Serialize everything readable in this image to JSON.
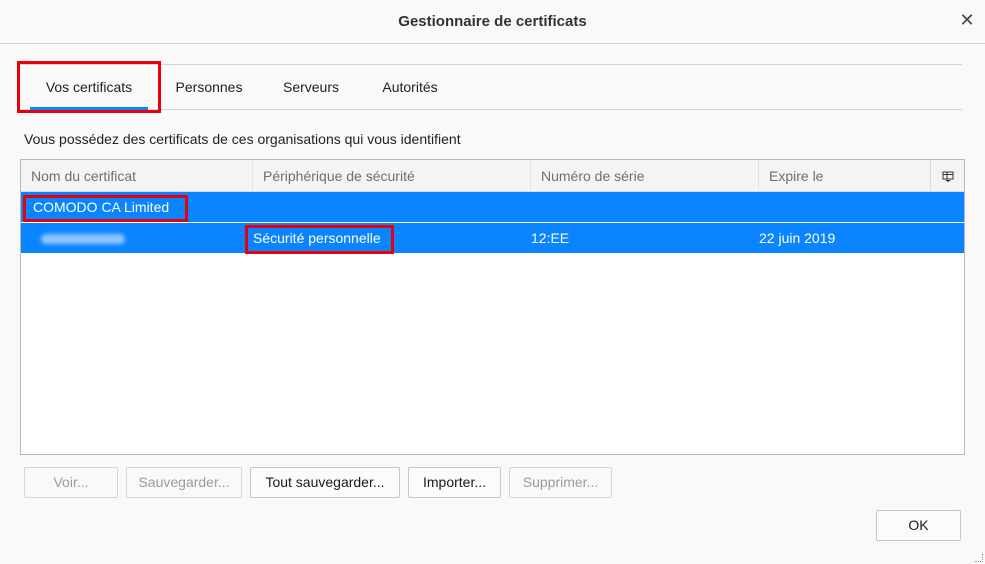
{
  "window": {
    "title": "Gestionnaire de certificats",
    "close_glyph": "✕"
  },
  "tabs": [
    {
      "label": "Vos certificats",
      "active": true
    },
    {
      "label": "Personnes",
      "active": false
    },
    {
      "label": "Serveurs",
      "active": false
    },
    {
      "label": "Autorités",
      "active": false
    }
  ],
  "description": "Vous possédez des certificats de ces organisations qui vous identifient",
  "table": {
    "columns": [
      "Nom du certificat",
      "Périphérique de sécurité",
      "Numéro de série",
      "Expire le"
    ],
    "column_picker_icon": "column-picker-icon",
    "group": {
      "name": "COMODO CA Limited"
    },
    "rows": [
      {
        "name": "",
        "device": "Sécurité personnelle",
        "serial_prefix": "12:EE",
        "expires": "22 juin 2019"
      }
    ]
  },
  "buttons": {
    "view": "Voir...",
    "backup": "Sauvegarder...",
    "backup_all": "Tout sauvegarder...",
    "import": "Importer...",
    "delete": "Supprimer...",
    "ok": "OK"
  },
  "colors": {
    "selection": "#0a84ff",
    "highlight": "#e8000b",
    "tab_indicator": "#0a84ff"
  }
}
